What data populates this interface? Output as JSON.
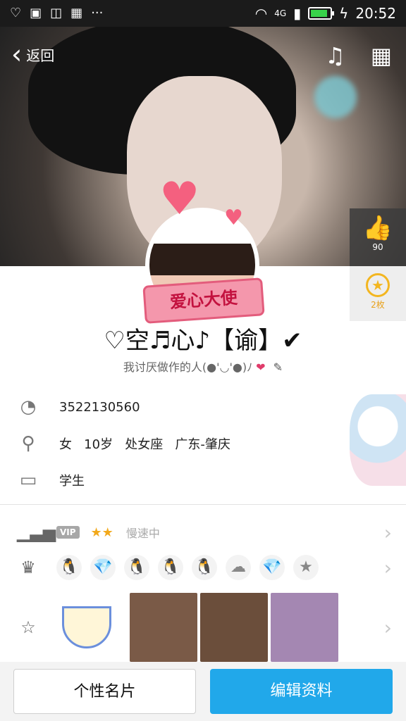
{
  "status_bar": {
    "network": "4G",
    "time": "20:52",
    "icons": [
      "heart-icon",
      "image-icon",
      "qq-icon",
      "app-icon",
      "more-icon"
    ]
  },
  "header": {
    "back_label": "返回",
    "music_icon": "music-play-icon",
    "qr_icon": "qr-code-icon"
  },
  "side": {
    "like_count": "90",
    "badge_label": "2枚"
  },
  "profile": {
    "ribbon_text": "爱心大使",
    "nickname": "♡空♬心♪【谕】✔",
    "signature": "我讨厌做作的人(●'◡'●)ﾉ",
    "signature_heart": "❤",
    "edit_icon": "✎"
  },
  "info": {
    "qq_number": "3522130560",
    "details": "女   10岁   处女座   广东-肇庆",
    "occupation": "学生"
  },
  "vip": {
    "badge": "VIP",
    "stars": "★★",
    "speed_text": "慢速中"
  },
  "badges": [
    "🐧",
    "💎",
    "🐧",
    "🐧",
    "🐧",
    "☁",
    "💎",
    "★"
  ],
  "photos_row": {
    "colors": [
      "#7a5a47",
      "#6b4e3b",
      "#a487b2"
    ]
  },
  "buttons": {
    "card_label": "个性名片",
    "edit_label": "编辑资料"
  },
  "colors": {
    "accent": "#21a8ea",
    "heart": "#e03c6b",
    "star": "#f2a91c"
  }
}
